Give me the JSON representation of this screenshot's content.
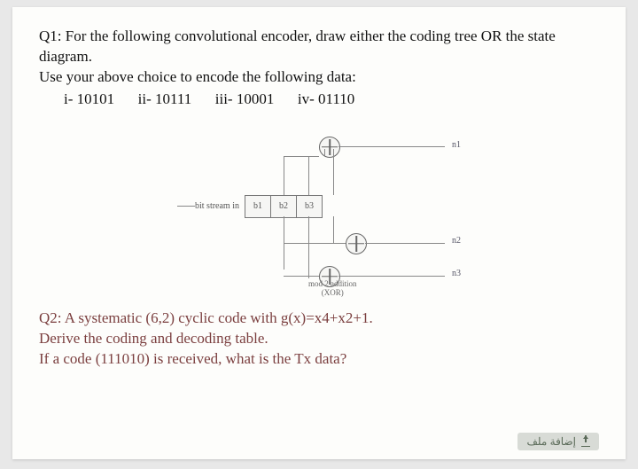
{
  "q1": {
    "line1": "Q1: For the following convolutional encoder, draw either the coding tree OR the state diagram.",
    "line2": "Use your above choice to encode the following data:",
    "items": {
      "i": "i-    10101",
      "ii": "ii- 10111",
      "iii": "iii- 10001",
      "iv": "iv- 01110"
    }
  },
  "diagram": {
    "input_label": "bit stream in",
    "regs": [
      "b1",
      "b2",
      "b3"
    ],
    "outputs": {
      "n1": "n1",
      "n2": "n2",
      "n3": "n3"
    },
    "xor_caption_line1": "mod 2 addition",
    "xor_caption_line2": "(XOR)"
  },
  "q2": {
    "line1": "Q2: A systematic (6,2) cyclic code with g(x)=x4+x2+1.",
    "line2": "Derive the coding and decoding table.",
    "line3": "If a code (111010) is received, what is the Tx data?"
  },
  "footer": {
    "label": "إضافة ملف"
  }
}
